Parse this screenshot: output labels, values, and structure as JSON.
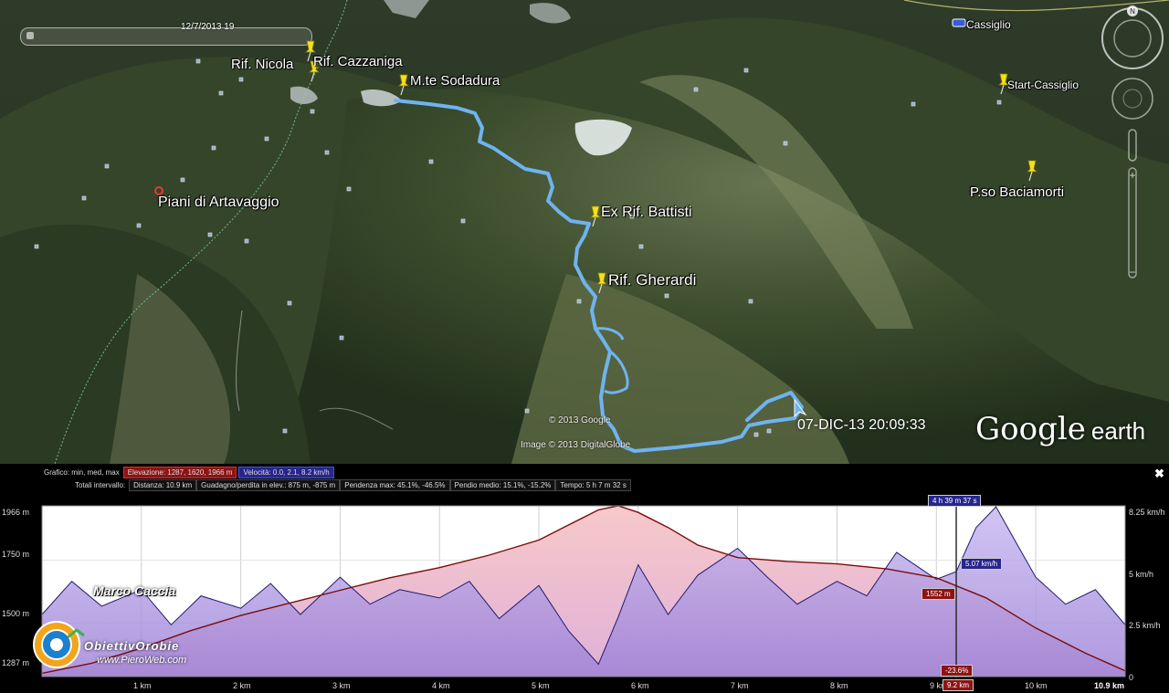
{
  "map": {
    "timeslider_label": "12/7/2013 19",
    "timestamp": "07-DIC-13 20:09:33",
    "logo_main": "Google",
    "logo_sub": "earth",
    "credit_google": "© 2013 Google",
    "credit_image": "Image © 2013 DigitalGlobe",
    "route_color": "#6fb3f0",
    "placemarks": [
      {
        "label": "Rif. Nicola",
        "icon": "pushpin-icon"
      },
      {
        "label": "Rif. Cazzaniga",
        "icon": "pushpin-icon"
      },
      {
        "label": "M.te Sodadura",
        "icon": "pushpin-icon"
      },
      {
        "label": "Cassiglio",
        "icon": "town-icon"
      },
      {
        "label": "Start-Cassiglio",
        "icon": "pushpin-icon"
      },
      {
        "label": "P.so Baciamorti",
        "icon": "pushpin-icon"
      },
      {
        "label": "Piani di Artavaggio",
        "icon": "town-icon"
      },
      {
        "label": "Ex Rif. Battisti",
        "icon": "pushpin-icon"
      },
      {
        "label": "Rif. Gherardi",
        "icon": "pushpin-icon"
      }
    ]
  },
  "profile": {
    "row1": {
      "prefix": "Grafico: min, med, max",
      "elev_label": "Elevazione: 1287, 1620, 1966 m",
      "speed_label": "Velocità: 0.0, 2.1, 8.2 km/h"
    },
    "row2": {
      "prefix": "Totali intervallo:",
      "distance": "Distanza: 10.9 km",
      "gain": "Guadagno/perdita in elev.: 875 m, -875 m",
      "slope_max": "Pendenza max: 45.1%, -46.5%",
      "slope_avg": "Pendio medio: 15.1%, -15.2%",
      "time": "Tempo: 5 h 7 m 32 s"
    },
    "y_left_ticks": [
      "1966 m",
      "1750 m",
      "1500 m",
      "1287 m"
    ],
    "y_right_ticks": [
      "8.25 km/h",
      "5 km/h",
      "2.5 km/h",
      "0"
    ],
    "x_ticks": [
      "1 km",
      "2 km",
      "3 km",
      "4 km",
      "5 km",
      "6 km",
      "7 km",
      "8 km",
      "9 km",
      "10 km"
    ],
    "x_end_label": "10.9 km",
    "cursor": {
      "time": "4 h 39 m 37 s",
      "speed": "5.07 km/h",
      "elevation": "1552 m",
      "slope": "-23.6%",
      "distance": "9.2 km"
    },
    "author": "Marco Caccia",
    "logo_name": "ObiettivOrobie",
    "logo_site": "www.PieroWeb.com",
    "close_symbol": "✖"
  },
  "chart_data": {
    "type": "area",
    "xlabel": "",
    "ylabel": "",
    "xlim": [
      0,
      10.9
    ],
    "ylim": [
      1287,
      1966
    ],
    "y2lim": [
      0,
      8.25
    ],
    "series": [
      {
        "name": "Elevazione",
        "unit": "m",
        "x": [
          0,
          0.5,
          1,
          1.5,
          2,
          2.5,
          3,
          3.5,
          4,
          4.5,
          5,
          5.3,
          5.6,
          5.8,
          6.0,
          6.3,
          6.6,
          7,
          7.5,
          8,
          8.5,
          9,
          9.5,
          10,
          10.5,
          10.9
        ],
        "y": [
          1300,
          1340,
          1400,
          1470,
          1530,
          1580,
          1630,
          1680,
          1720,
          1770,
          1830,
          1890,
          1950,
          1966,
          1940,
          1880,
          1810,
          1760,
          1745,
          1735,
          1715,
          1680,
          1600,
          1480,
          1380,
          1310
        ]
      },
      {
        "name": "Velocità",
        "unit": "km/h",
        "x": [
          0,
          0.3,
          0.6,
          1,
          1.3,
          1.6,
          2,
          2.3,
          2.6,
          3,
          3.3,
          3.6,
          4,
          4.3,
          4.6,
          5,
          5.3,
          5.6,
          5.8,
          6.0,
          6.3,
          6.6,
          7,
          7.3,
          7.6,
          8,
          8.3,
          8.6,
          9,
          9.2,
          9.4,
          9.6,
          9.8,
          10,
          10.3,
          10.6,
          10.9
        ],
        "y": [
          3.0,
          4.6,
          3.4,
          4.2,
          2.5,
          3.9,
          3.3,
          4.5,
          3.0,
          4.8,
          3.5,
          4.2,
          3.8,
          4.6,
          2.8,
          4.4,
          2.2,
          0.6,
          2.9,
          5.4,
          3.0,
          4.9,
          6.2,
          4.8,
          3.5,
          4.6,
          3.9,
          6.0,
          4.7,
          5.07,
          7.2,
          8.2,
          6.5,
          4.8,
          3.5,
          4.2,
          2.5
        ]
      }
    ],
    "cursor": {
      "x": 9.2,
      "elevation": 1552,
      "speed": 5.07,
      "slope_pct": -23.6,
      "time": "4 h 39 m 37 s"
    }
  }
}
